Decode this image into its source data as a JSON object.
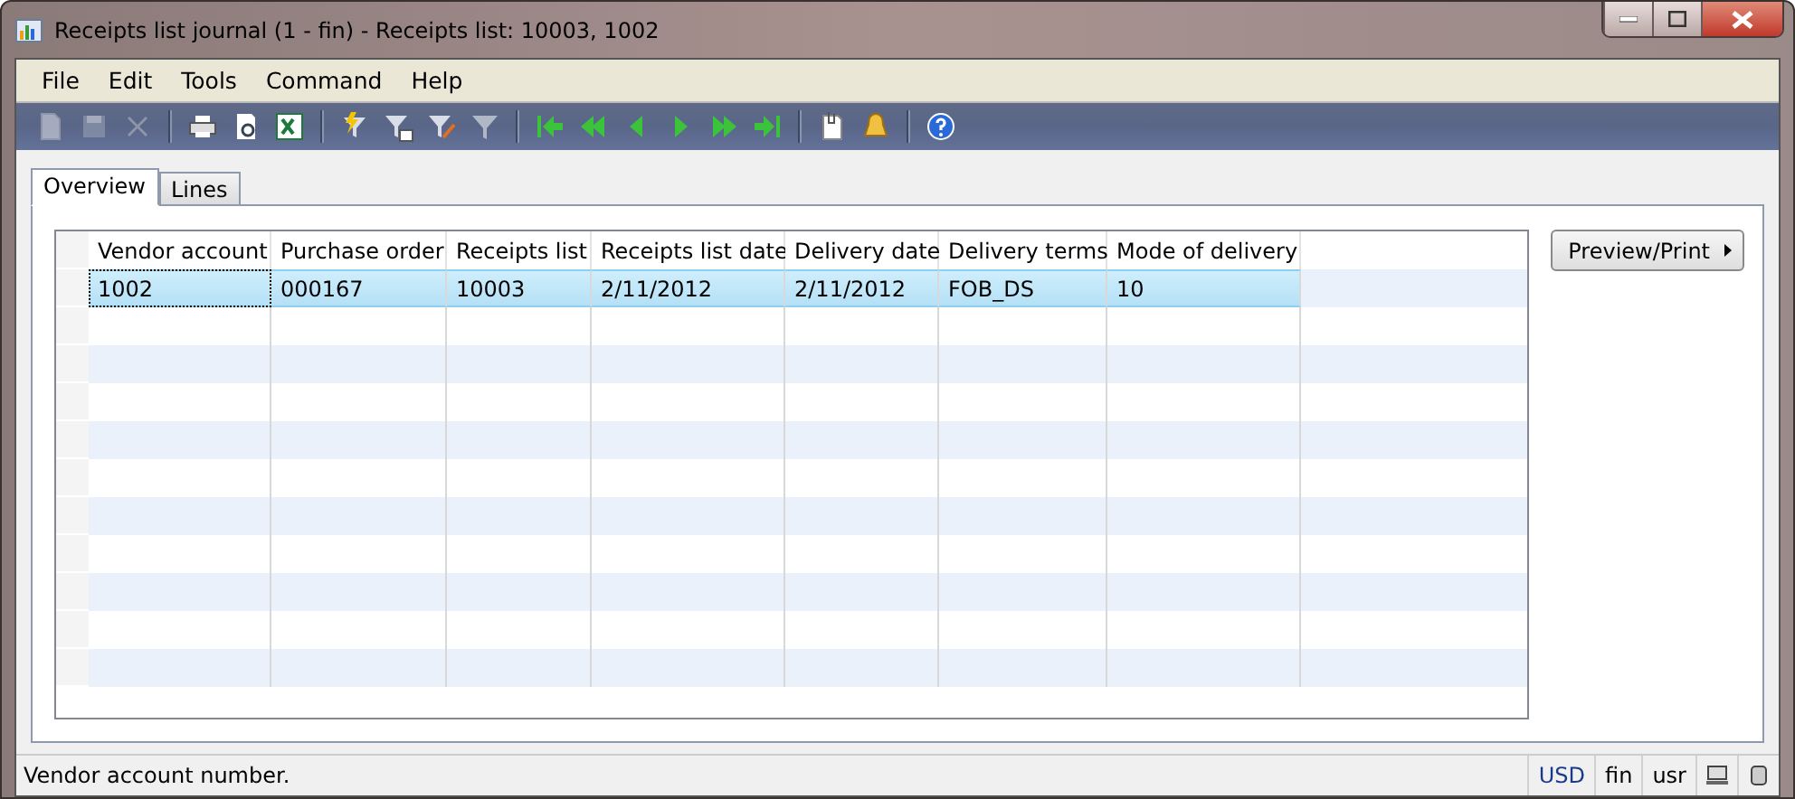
{
  "window": {
    "title": "Receipts list journal (1 - fin) - Receipts list: 10003, 1002"
  },
  "menu": [
    "File",
    "Edit",
    "Tools",
    "Command",
    "Help"
  ],
  "toolbar": [
    [
      {
        "kind": "new",
        "disabled": true
      },
      {
        "kind": "save",
        "disabled": true
      },
      {
        "kind": "delete",
        "disabled": true
      }
    ],
    [
      {
        "kind": "print",
        "disabled": false
      },
      {
        "kind": "preview",
        "disabled": false
      },
      {
        "kind": "excel",
        "disabled": false
      }
    ],
    [
      {
        "kind": "filter-quick",
        "disabled": false
      },
      {
        "kind": "filter-grid",
        "disabled": false
      },
      {
        "kind": "filter-edit",
        "disabled": false
      },
      {
        "kind": "filter-clear",
        "disabled": false
      }
    ],
    [
      {
        "kind": "first",
        "disabled": false
      },
      {
        "kind": "prev-page",
        "disabled": false
      },
      {
        "kind": "prev",
        "disabled": false
      },
      {
        "kind": "next",
        "disabled": false
      },
      {
        "kind": "next-page",
        "disabled": false
      },
      {
        "kind": "last",
        "disabled": false
      }
    ],
    [
      {
        "kind": "attach",
        "disabled": false
      },
      {
        "kind": "alert",
        "disabled": false
      }
    ],
    [
      {
        "kind": "help",
        "disabled": false
      }
    ]
  ],
  "tabs": [
    {
      "label": "Overview",
      "selected": true
    },
    {
      "label": "Lines",
      "selected": false
    }
  ],
  "table": {
    "columns": [
      "Vendor account",
      "Purchase order",
      "Receipts list",
      "Receipts list date",
      "Delivery date",
      "Delivery terms",
      "Mode of delivery"
    ],
    "rows": [
      {
        "selected": true,
        "cells": [
          "1002",
          "000167",
          "10003",
          "2/11/2012",
          "2/11/2012",
          "FOB_DS",
          "10"
        ]
      }
    ]
  },
  "preview_button": "Preview/Print",
  "status_bar": {
    "message": "Vendor account number.",
    "currency": "USD",
    "company": "fin",
    "user": "usr"
  }
}
